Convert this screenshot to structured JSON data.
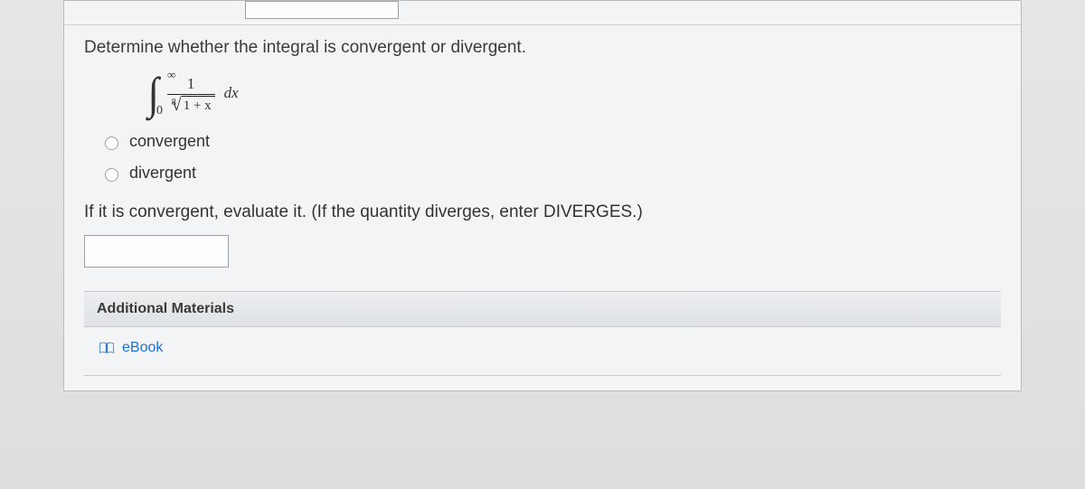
{
  "question": {
    "prompt": "Determine whether the integral is convergent or divergent.",
    "integral": {
      "upper": "∞",
      "lower": "0",
      "numerator": "1",
      "root_index": "8",
      "radicand": "1 + x",
      "differential": "dx"
    },
    "options": [
      {
        "label": "convergent"
      },
      {
        "label": "divergent"
      }
    ],
    "sub_prompt": "If it is convergent, evaluate it. (If the quantity diverges, enter DIVERGES.)",
    "answer_value": ""
  },
  "materials": {
    "header": "Additional Materials",
    "ebook_label": "eBook"
  }
}
